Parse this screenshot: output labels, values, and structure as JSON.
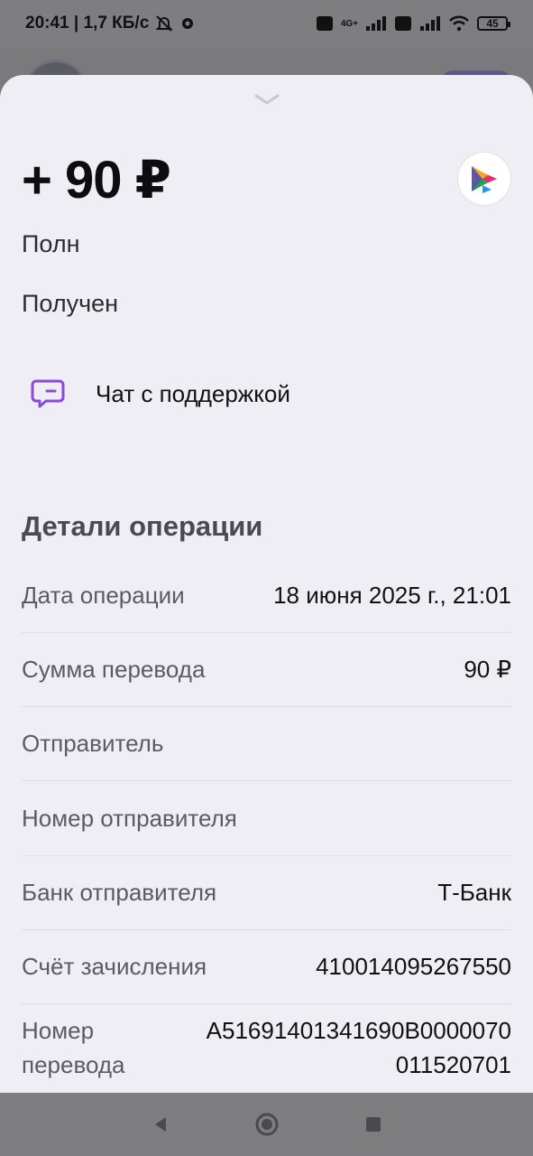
{
  "status_bar": {
    "time_speed": "20:41 | 1,7 КБ/с",
    "battery": "45",
    "network_badge": "4G+"
  },
  "transaction": {
    "amount": "+ 90 ₽",
    "name_partial": "Полн",
    "status": "Получен"
  },
  "support": {
    "label": "Чат с поддержкой"
  },
  "details": {
    "title": "Детали операции",
    "rows": [
      {
        "label": "Дата операции",
        "value": "18 июня 2025 г., 21:01"
      },
      {
        "label": "Сумма перевода",
        "value": "90 ₽"
      },
      {
        "label": "Отправитель",
        "value": ""
      },
      {
        "label": "Номер отправителя",
        "value": ""
      },
      {
        "label": "Банк отправителя",
        "value": "Т-Банк"
      },
      {
        "label": "Счёт зачисления",
        "value": "410014095267550"
      },
      {
        "label": "Номер перевода",
        "value": "A51691401341690B0000070011520701"
      }
    ]
  },
  "colors": {
    "accent_purple": "#8a4bdc",
    "sheet_bg": "#efeef4",
    "overlay": "#7a7a7d"
  },
  "icons": {
    "collapse": "chevron-down-icon",
    "support": "chat-bubble-icon",
    "bank": "sbp-logo-icon"
  }
}
